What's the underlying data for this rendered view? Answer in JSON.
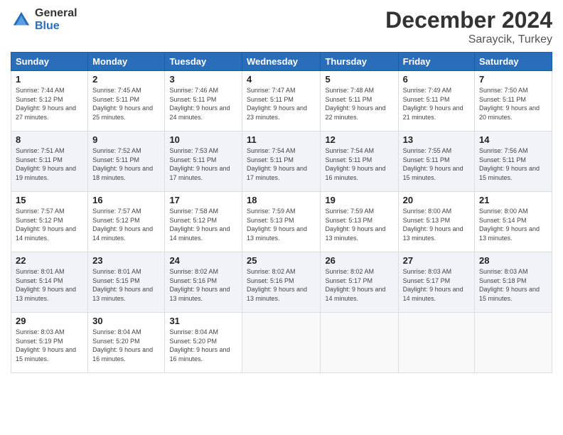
{
  "header": {
    "logo_general": "General",
    "logo_blue": "Blue",
    "month_title": "December 2024",
    "location": "Saraycik, Turkey"
  },
  "days_of_week": [
    "Sunday",
    "Monday",
    "Tuesday",
    "Wednesday",
    "Thursday",
    "Friday",
    "Saturday"
  ],
  "weeks": [
    [
      {
        "day": "1",
        "sunrise": "7:44 AM",
        "sunset": "5:12 PM",
        "daylight": "9 hours and 27 minutes."
      },
      {
        "day": "2",
        "sunrise": "7:45 AM",
        "sunset": "5:11 PM",
        "daylight": "9 hours and 25 minutes."
      },
      {
        "day": "3",
        "sunrise": "7:46 AM",
        "sunset": "5:11 PM",
        "daylight": "9 hours and 24 minutes."
      },
      {
        "day": "4",
        "sunrise": "7:47 AM",
        "sunset": "5:11 PM",
        "daylight": "9 hours and 23 minutes."
      },
      {
        "day": "5",
        "sunrise": "7:48 AM",
        "sunset": "5:11 PM",
        "daylight": "9 hours and 22 minutes."
      },
      {
        "day": "6",
        "sunrise": "7:49 AM",
        "sunset": "5:11 PM",
        "daylight": "9 hours and 21 minutes."
      },
      {
        "day": "7",
        "sunrise": "7:50 AM",
        "sunset": "5:11 PM",
        "daylight": "9 hours and 20 minutes."
      }
    ],
    [
      {
        "day": "8",
        "sunrise": "7:51 AM",
        "sunset": "5:11 PM",
        "daylight": "9 hours and 19 minutes."
      },
      {
        "day": "9",
        "sunrise": "7:52 AM",
        "sunset": "5:11 PM",
        "daylight": "9 hours and 18 minutes."
      },
      {
        "day": "10",
        "sunrise": "7:53 AM",
        "sunset": "5:11 PM",
        "daylight": "9 hours and 17 minutes."
      },
      {
        "day": "11",
        "sunrise": "7:54 AM",
        "sunset": "5:11 PM",
        "daylight": "9 hours and 17 minutes."
      },
      {
        "day": "12",
        "sunrise": "7:54 AM",
        "sunset": "5:11 PM",
        "daylight": "9 hours and 16 minutes."
      },
      {
        "day": "13",
        "sunrise": "7:55 AM",
        "sunset": "5:11 PM",
        "daylight": "9 hours and 15 minutes."
      },
      {
        "day": "14",
        "sunrise": "7:56 AM",
        "sunset": "5:11 PM",
        "daylight": "9 hours and 15 minutes."
      }
    ],
    [
      {
        "day": "15",
        "sunrise": "7:57 AM",
        "sunset": "5:12 PM",
        "daylight": "9 hours and 14 minutes."
      },
      {
        "day": "16",
        "sunrise": "7:57 AM",
        "sunset": "5:12 PM",
        "daylight": "9 hours and 14 minutes."
      },
      {
        "day": "17",
        "sunrise": "7:58 AM",
        "sunset": "5:12 PM",
        "daylight": "9 hours and 14 minutes."
      },
      {
        "day": "18",
        "sunrise": "7:59 AM",
        "sunset": "5:13 PM",
        "daylight": "9 hours and 13 minutes."
      },
      {
        "day": "19",
        "sunrise": "7:59 AM",
        "sunset": "5:13 PM",
        "daylight": "9 hours and 13 minutes."
      },
      {
        "day": "20",
        "sunrise": "8:00 AM",
        "sunset": "5:13 PM",
        "daylight": "9 hours and 13 minutes."
      },
      {
        "day": "21",
        "sunrise": "8:00 AM",
        "sunset": "5:14 PM",
        "daylight": "9 hours and 13 minutes."
      }
    ],
    [
      {
        "day": "22",
        "sunrise": "8:01 AM",
        "sunset": "5:14 PM",
        "daylight": "9 hours and 13 minutes."
      },
      {
        "day": "23",
        "sunrise": "8:01 AM",
        "sunset": "5:15 PM",
        "daylight": "9 hours and 13 minutes."
      },
      {
        "day": "24",
        "sunrise": "8:02 AM",
        "sunset": "5:16 PM",
        "daylight": "9 hours and 13 minutes."
      },
      {
        "day": "25",
        "sunrise": "8:02 AM",
        "sunset": "5:16 PM",
        "daylight": "9 hours and 13 minutes."
      },
      {
        "day": "26",
        "sunrise": "8:02 AM",
        "sunset": "5:17 PM",
        "daylight": "9 hours and 14 minutes."
      },
      {
        "day": "27",
        "sunrise": "8:03 AM",
        "sunset": "5:17 PM",
        "daylight": "9 hours and 14 minutes."
      },
      {
        "day": "28",
        "sunrise": "8:03 AM",
        "sunset": "5:18 PM",
        "daylight": "9 hours and 15 minutes."
      }
    ],
    [
      {
        "day": "29",
        "sunrise": "8:03 AM",
        "sunset": "5:19 PM",
        "daylight": "9 hours and 15 minutes."
      },
      {
        "day": "30",
        "sunrise": "8:04 AM",
        "sunset": "5:20 PM",
        "daylight": "9 hours and 16 minutes."
      },
      {
        "day": "31",
        "sunrise": "8:04 AM",
        "sunset": "5:20 PM",
        "daylight": "9 hours and 16 minutes."
      },
      null,
      null,
      null,
      null
    ]
  ]
}
